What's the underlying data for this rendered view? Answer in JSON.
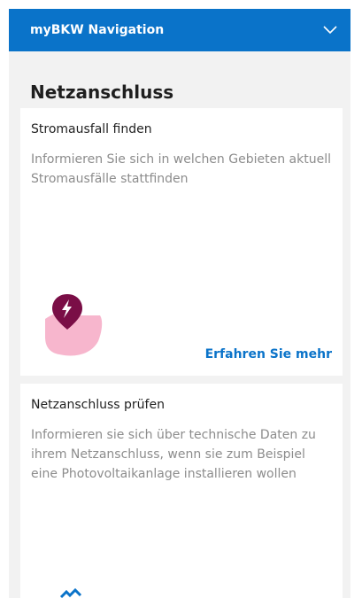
{
  "topbar": {
    "title": "myBKW Navigation",
    "icon": "chevron-down-icon",
    "color": "#0a73c9"
  },
  "section": {
    "title": "Netzanschluss"
  },
  "cards": [
    {
      "title": "Stromausfall finden",
      "description": "Informieren Sie sich in welchen Gebieten aktuell Stromausfälle stattfinden",
      "link": "Erfahren Sie mehr",
      "illustration": "map-pin-lightning-icon"
    },
    {
      "title": "Netzanschluss prüfen",
      "description": "Informieren sie sich über technische Daten zu ihrem Netzanschluss, wenn sie zum Beispiel eine Photovoltaikanlage installieren wollen"
    }
  ],
  "colors": {
    "accent": "#0a73c9",
    "pin": "#7a0e46",
    "map": "#f7b6cd",
    "background": "#f2f2f2"
  }
}
